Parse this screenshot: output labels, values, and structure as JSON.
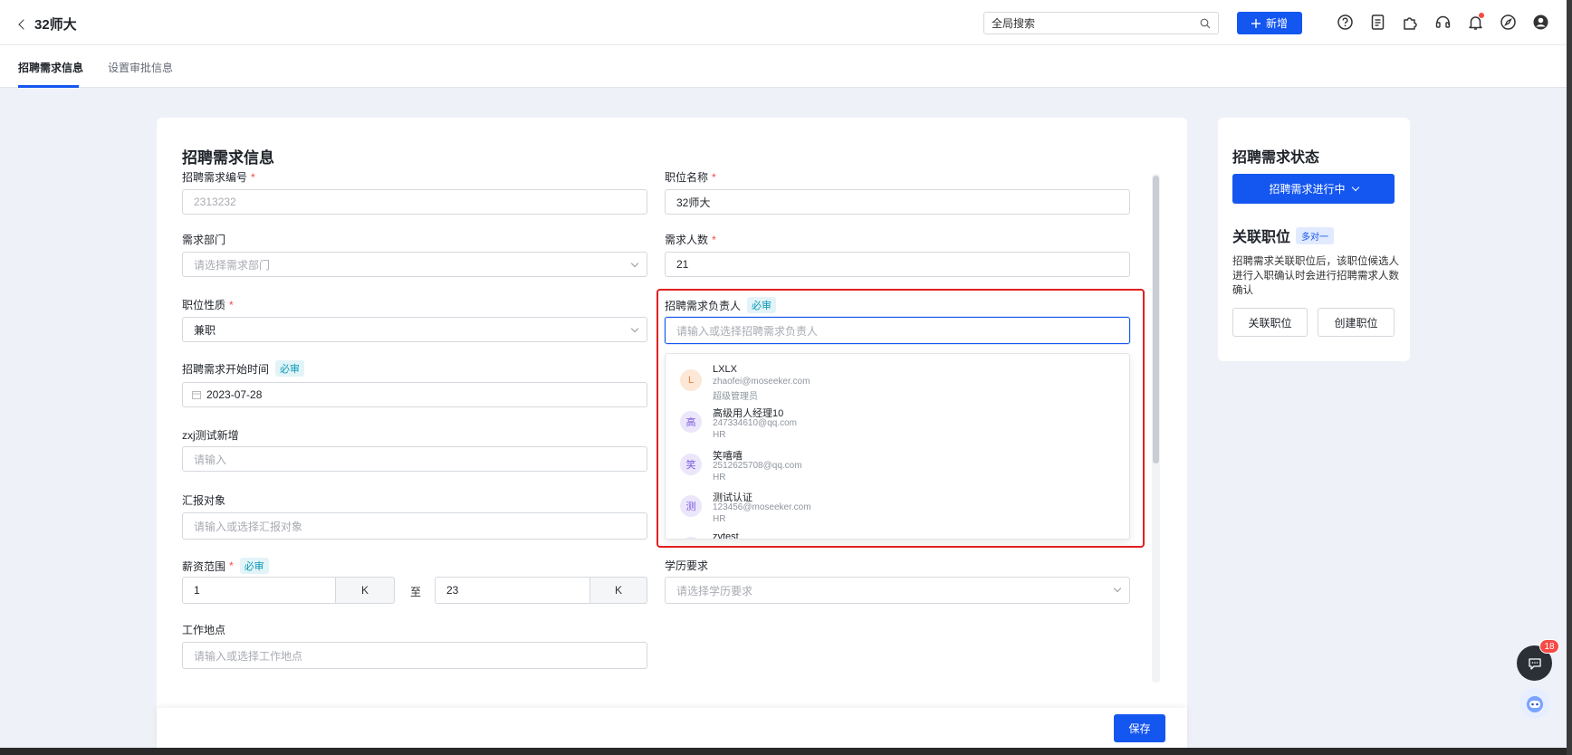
{
  "header": {
    "title": "32师大",
    "search_placeholder": "全局搜索",
    "new_button": "新增",
    "notification_badge": "",
    "icons": [
      "help-icon",
      "document-icon",
      "plugin-icon",
      "support-icon",
      "bell-icon",
      "compass-icon",
      "user-icon"
    ]
  },
  "tabs": [
    {
      "label": "招聘需求信息",
      "active": true
    },
    {
      "label": "设置审批信息",
      "active": false
    }
  ],
  "form": {
    "title": "招聘需求信息",
    "required_tag": "必审",
    "req_no": {
      "label": "招聘需求编号",
      "placeholder": "2313232"
    },
    "job_title": {
      "label": "职位名称",
      "value": "32师大"
    },
    "department": {
      "label": "需求部门",
      "placeholder": "请选择需求部门"
    },
    "headcount": {
      "label": "需求人数",
      "value": "21"
    },
    "job_nature": {
      "label": "职位性质",
      "value": "兼职"
    },
    "owner": {
      "label": "招聘需求负责人",
      "placeholder": "请输入或选择招聘需求负责人"
    },
    "start_date": {
      "label": "招聘需求开始时间",
      "value": "2023-07-28"
    },
    "custom_field": {
      "label": "zxj测试新增",
      "placeholder": "请输入"
    },
    "report_to": {
      "label": "汇报对象",
      "placeholder": "请输入或选择汇报对象"
    },
    "salary": {
      "label": "薪资范围",
      "min": "1",
      "max": "23",
      "unit": "K",
      "separator": "至"
    },
    "education": {
      "label": "学历要求",
      "placeholder": "请选择学历要求"
    },
    "location": {
      "label": "工作地点",
      "placeholder": "请输入或选择工作地点"
    }
  },
  "owner_options": [
    {
      "avatar": "L",
      "name": "LXLX",
      "email": "zhaofei@moseeker.com",
      "role": "超级管理员",
      "color": "#fde7d6",
      "text_color": "#e8833a"
    },
    {
      "avatar": "高",
      "name": "高级用人经理10",
      "email": "247334610@qq.com",
      "role": "HR",
      "color": "#ece6fb",
      "text_color": "#7a5ae0"
    },
    {
      "avatar": "笑",
      "name": "笑嘻嘻",
      "email": "2512625708@qq.com",
      "role": "HR",
      "color": "#ece6fb",
      "text_color": "#7a5ae0"
    },
    {
      "avatar": "测",
      "name": "测试认证",
      "email": "123456@moseeker.com",
      "role": "HR",
      "color": "#ece6fb",
      "text_color": "#7a5ae0"
    },
    {
      "avatar": "z",
      "name": "zytest",
      "email": "",
      "role": "",
      "color": "#ece6fb",
      "text_color": "#7a5ae0"
    }
  ],
  "side": {
    "status_title": "招聘需求状态",
    "status_button": "招聘需求进行中",
    "relation_title": "关联职位",
    "relation_tag": "多对一",
    "relation_desc": "招聘需求关联职位后，该职位候选人进行入职确认时会进行招聘需求人数确认",
    "link_button": "关联职位",
    "create_button": "创建职位"
  },
  "footer": {
    "save": "保存"
  },
  "floating": {
    "chat_badge": "18"
  },
  "colors": {
    "primary": "#1456f0",
    "danger": "#f54a45",
    "highlight": "#e02020"
  }
}
